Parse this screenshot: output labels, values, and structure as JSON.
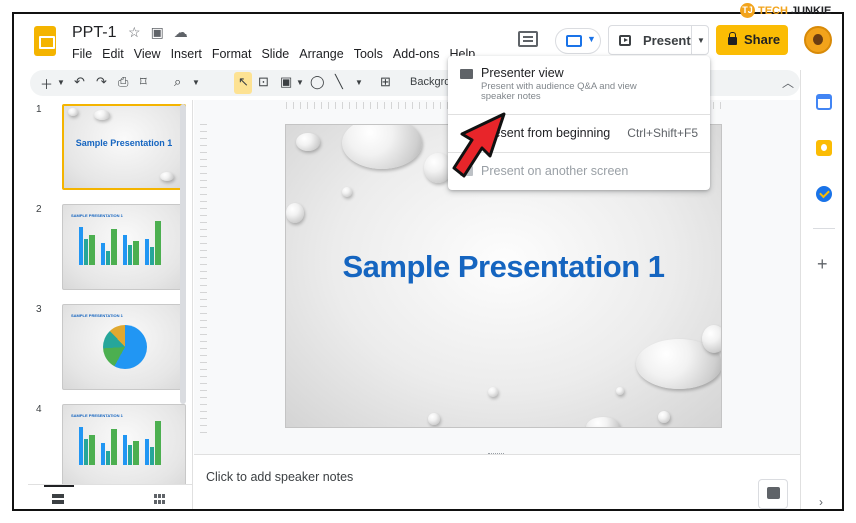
{
  "watermark": {
    "badge": "TJ",
    "part1": "TECH",
    "part2": "JUNKIE"
  },
  "app": {
    "title": "PPT-1",
    "menu": [
      "File",
      "Edit",
      "View",
      "Insert",
      "Format",
      "Slide",
      "Arrange",
      "Tools",
      "Add-ons",
      "Help"
    ],
    "present_label": "Present",
    "share_label": "Share"
  },
  "toolbar": {
    "background_label": "Background"
  },
  "present_menu": {
    "items": [
      {
        "label": "Presenter view",
        "description": "Present with audience Q&A and view speaker notes"
      },
      {
        "label": "Present from beginning",
        "shortcut": "Ctrl+Shift+F5"
      },
      {
        "label": "Present on another screen",
        "disabled": true
      }
    ]
  },
  "slides": [
    {
      "number": "1",
      "title": "Sample Presentation 1",
      "kind": "title",
      "selected": true
    },
    {
      "number": "2",
      "title": "SAMPLE PRESENTATION 1",
      "kind": "bar-chart"
    },
    {
      "number": "3",
      "title": "SAMPLE PRESENTATION 1",
      "kind": "pie-chart"
    },
    {
      "number": "4",
      "title": "SAMPLE PRESENTATION 1",
      "kind": "bar-chart"
    }
  ],
  "canvas": {
    "slide_title": "Sample Presentation 1"
  },
  "notes": {
    "placeholder": "Click to add speaker notes"
  },
  "colors": {
    "accent_yellow": "#fbbc04",
    "slide_title_blue": "#1565c0",
    "selection_border": "#f4b400"
  }
}
